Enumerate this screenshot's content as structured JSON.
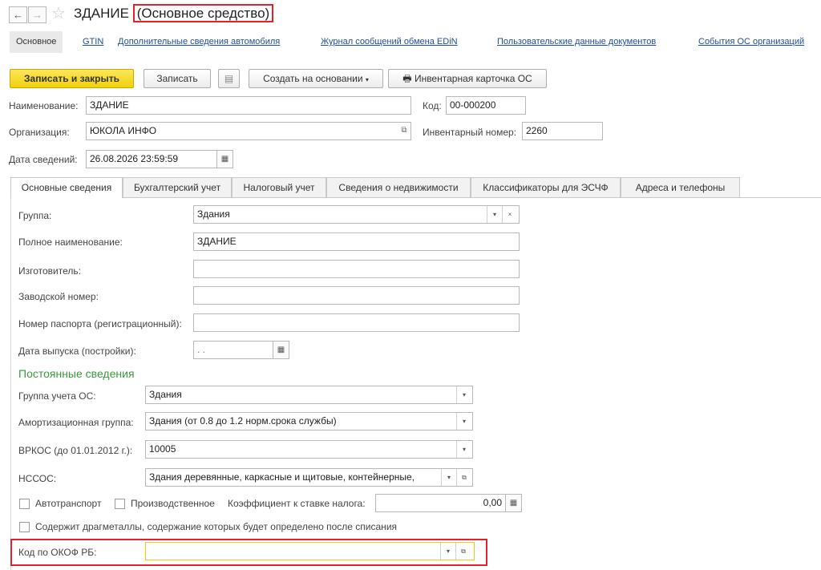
{
  "window": {
    "title_main": "ЗДАНИЕ",
    "title_suffix": "(Основное средство)"
  },
  "top_tabs": [
    {
      "label": "Основное",
      "active": true
    },
    {
      "label": "GTIN"
    },
    {
      "label": "Дополнительные сведения автомобиля"
    },
    {
      "label": "Журнал сообщений обмена EDiN"
    },
    {
      "label": "Пользовательские данные документов"
    },
    {
      "label": "События ОС организаций"
    }
  ],
  "toolbar": {
    "save_close": "Записать и закрыть",
    "save": "Записать",
    "create_based": "Создать на основании",
    "inventory_card": "Инвентарная карточка ОС"
  },
  "header": {
    "name_label": "Наименование:",
    "name_value": "ЗДАНИЕ",
    "code_label": "Код:",
    "code_value": "00-000200",
    "org_label": "Организация:",
    "org_value": "ЮКОЛА ИНФО",
    "inv_label": "Инвентарный номер:",
    "inv_value": "2260",
    "date_label": "Дата сведений:",
    "date_value": "26.08.2026 23:59:59"
  },
  "content_tabs": [
    {
      "label": "Основные сведения",
      "active": true
    },
    {
      "label": "Бухгалтерский учет"
    },
    {
      "label": "Налоговый учет"
    },
    {
      "label": "Сведения о недвижимости"
    },
    {
      "label": "Классификаторы для ЭСЧФ"
    },
    {
      "label": "Адреса и телефоны"
    }
  ],
  "main": {
    "group_label": "Группа:",
    "group_value": "Здания",
    "fullname_label": "Полное наименование:",
    "fullname_value": "ЗДАНИЕ",
    "maker_label": "Изготовитель:",
    "maker_value": "",
    "serial_label": "Заводской номер:",
    "serial_value": "",
    "passport_label": "Номер паспорта (регистрационный):",
    "passport_value": "",
    "release_label": "Дата выпуска (постройки):",
    "release_value": "  .  .",
    "section_title": "Постоянные сведения",
    "os_group_label": "Группа учета ОС:",
    "os_group_value": "Здания",
    "amort_label": "Амортизационная группа:",
    "amort_value": "Здания (от 0.8 до 1.2 норм.срока службы)",
    "vrkos_label": "ВРКОС (до 01.01.2012 г.):",
    "vrkos_value": "10005",
    "nssos_label": "НССОС:",
    "nssos_value": "Здания деревянные, каркасные и щитовые, контейнерные,",
    "auto_label": "Автотранспорт",
    "production_label": "Производственное",
    "coef_label": "Коэффициент к ставке налога:",
    "coef_value": "0,00",
    "metals_label": "Содержит драгметаллы, содержание которых будет определено после списания",
    "okof_label": "Код по ОКОФ РБ:",
    "okof_value": ""
  }
}
